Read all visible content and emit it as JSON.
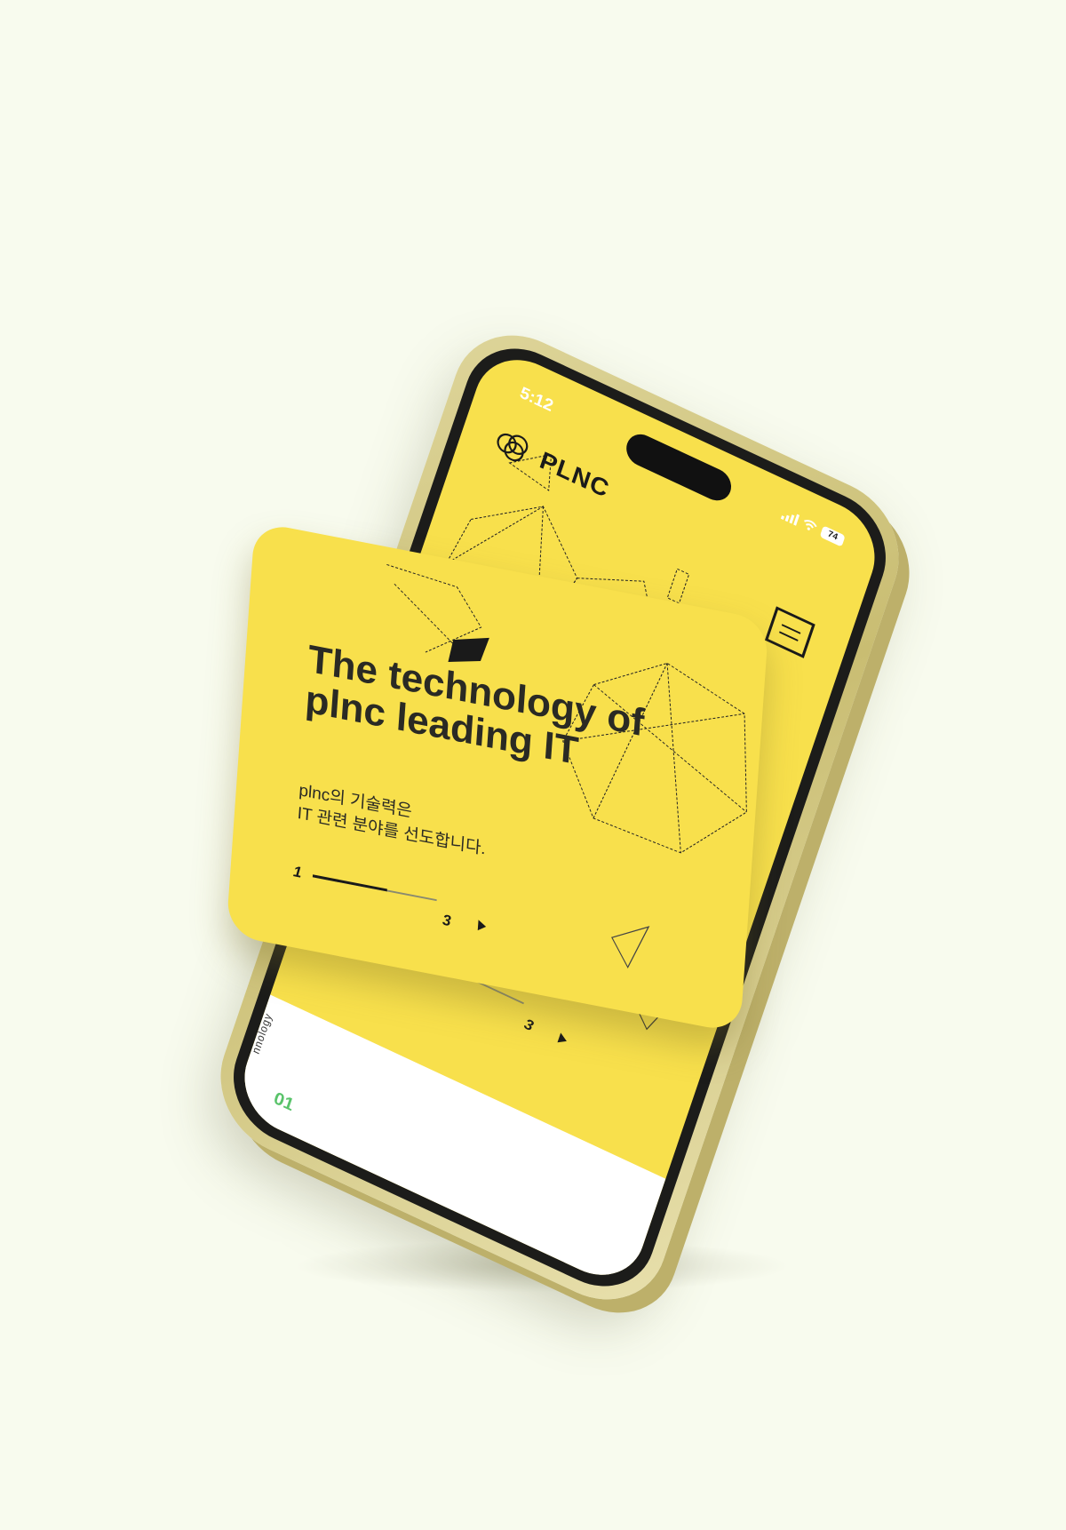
{
  "status_bar": {
    "time": "5:12",
    "battery": "74"
  },
  "header": {
    "logo_text": "PLNC"
  },
  "hero": {
    "headline": "The technology of plnc leading IT",
    "subtitle_line1": "plnc의 기술력은",
    "subtitle_line2": "IT 관련 분야를 선도합니다."
  },
  "pager": {
    "current": "1",
    "total": "3",
    "progress": 0.6
  },
  "section": {
    "label": "nnology",
    "number": "01"
  },
  "colors": {
    "background": "#f8fbee",
    "accent": "#f8e04c",
    "text": "#2a2a24",
    "number_green": "#59c36a"
  }
}
